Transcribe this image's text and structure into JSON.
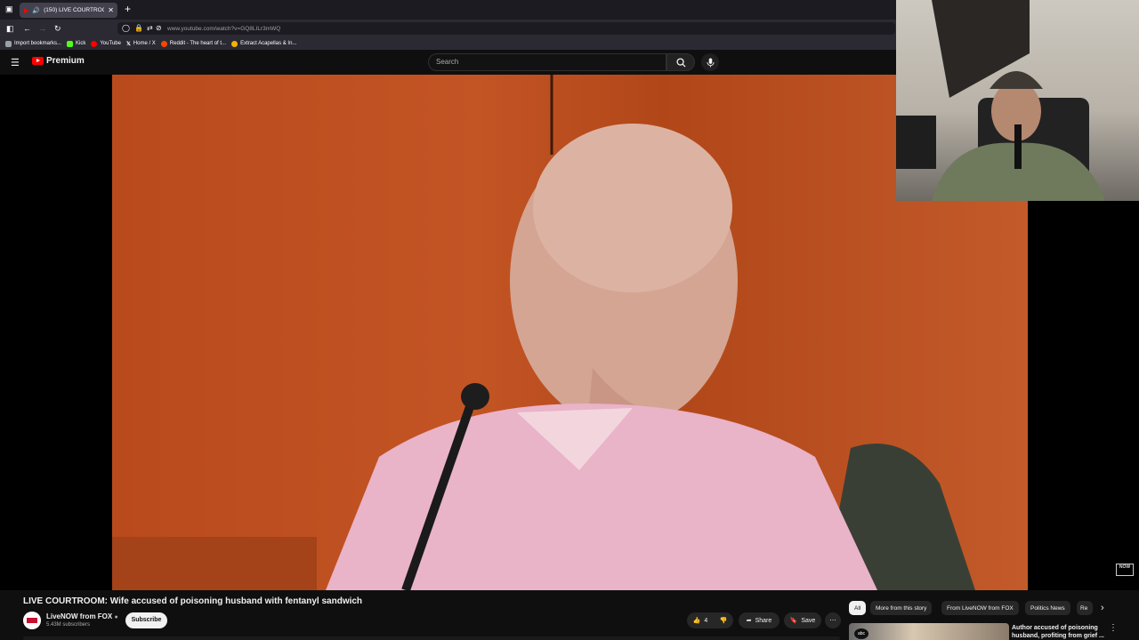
{
  "browser": {
    "tab_title": "(150) LIVE COURTROOM: W",
    "url": "www.youtube.com/watch?v=GQ8LILr3mWQ",
    "bookmarks": [
      {
        "label": "Import bookmarks...",
        "color": "#9aa0a6"
      },
      {
        "label": "Kick",
        "color": "#53fc18"
      },
      {
        "label": "YouTube",
        "color": "#ff0000"
      },
      {
        "label": "Home / X",
        "color": "#ffffff"
      },
      {
        "label": "Reddit - The heart of t...",
        "color": "#ff4500"
      },
      {
        "label": "Extract Acapellas & In...",
        "color": "#f5b301"
      }
    ]
  },
  "youtube": {
    "logo_text": "Premium",
    "search_placeholder": "Search"
  },
  "video": {
    "title": "LIVE COURTROOM: Wife accused of poisoning husband with fentanyl sandwich",
    "watermark": "NOW",
    "channel": {
      "name": "LiveNOW from FOX",
      "subscribers": "5.43M subscribers",
      "subscribe_label": "Subscribe"
    },
    "actions": {
      "like_count": "4",
      "share_label": "Share",
      "save_label": "Save"
    }
  },
  "chips": [
    "All",
    "More from this story",
    "From LiveNOW from FOX",
    "Politics News",
    "Re"
  ],
  "recommended": {
    "title": "Author accused of poisoning husband, profiting from grief ..."
  },
  "colors": {
    "accent_red": "#ff0000",
    "page_bg": "#0f0f0f",
    "wall_orange": "#c35424"
  }
}
